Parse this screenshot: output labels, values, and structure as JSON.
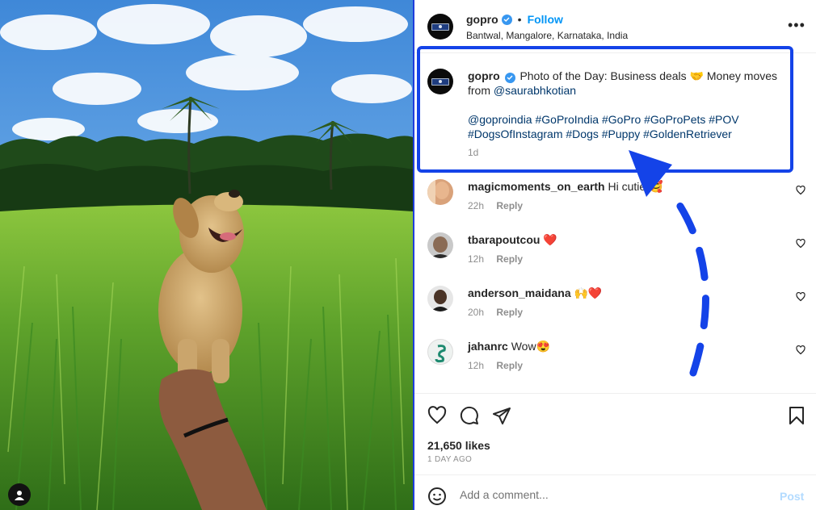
{
  "post": {
    "username": "gopro",
    "follow_label": "Follow",
    "separator": "•",
    "location": "Bantwal, Mangalore, Karnataka, India",
    "more_icon": "more-horizontal-icon"
  },
  "caption": {
    "username": "gopro",
    "text": "Photo of the Day: Business deals 🤝 Money moves from ",
    "mention": "@saurabhkotian",
    "hashtags_line1": "@goproindia #GoProIndia #GoPro #GoProPets #POV",
    "hashtags_line2": "#DogsOfInstagram #Dogs #Puppy #GoldenRetriever",
    "time": "1d"
  },
  "comments": [
    {
      "username": "magicmoments_on_earth",
      "text": "Hi cutie 🥰",
      "time": "22h",
      "reply": "Reply"
    },
    {
      "username": "tbarapoutcou",
      "text": "❤️",
      "time": "12h",
      "reply": "Reply"
    },
    {
      "username": "anderson_maidana",
      "text": "🙌❤️",
      "time": "20h",
      "reply": "Reply"
    },
    {
      "username": "jahanrc",
      "text": "Wow😍",
      "time": "12h",
      "reply": "Reply"
    }
  ],
  "actions": {
    "icons": [
      "heart-icon",
      "comment-icon",
      "share-icon",
      "bookmark-icon"
    ],
    "likes": "21,650 likes",
    "ago": "1 DAY AGO"
  },
  "add_comment": {
    "placeholder": "Add a comment...",
    "post_label": "Post"
  },
  "colors": {
    "accent": "#0095f6",
    "highlight": "#1443e8",
    "link": "#00376b"
  }
}
